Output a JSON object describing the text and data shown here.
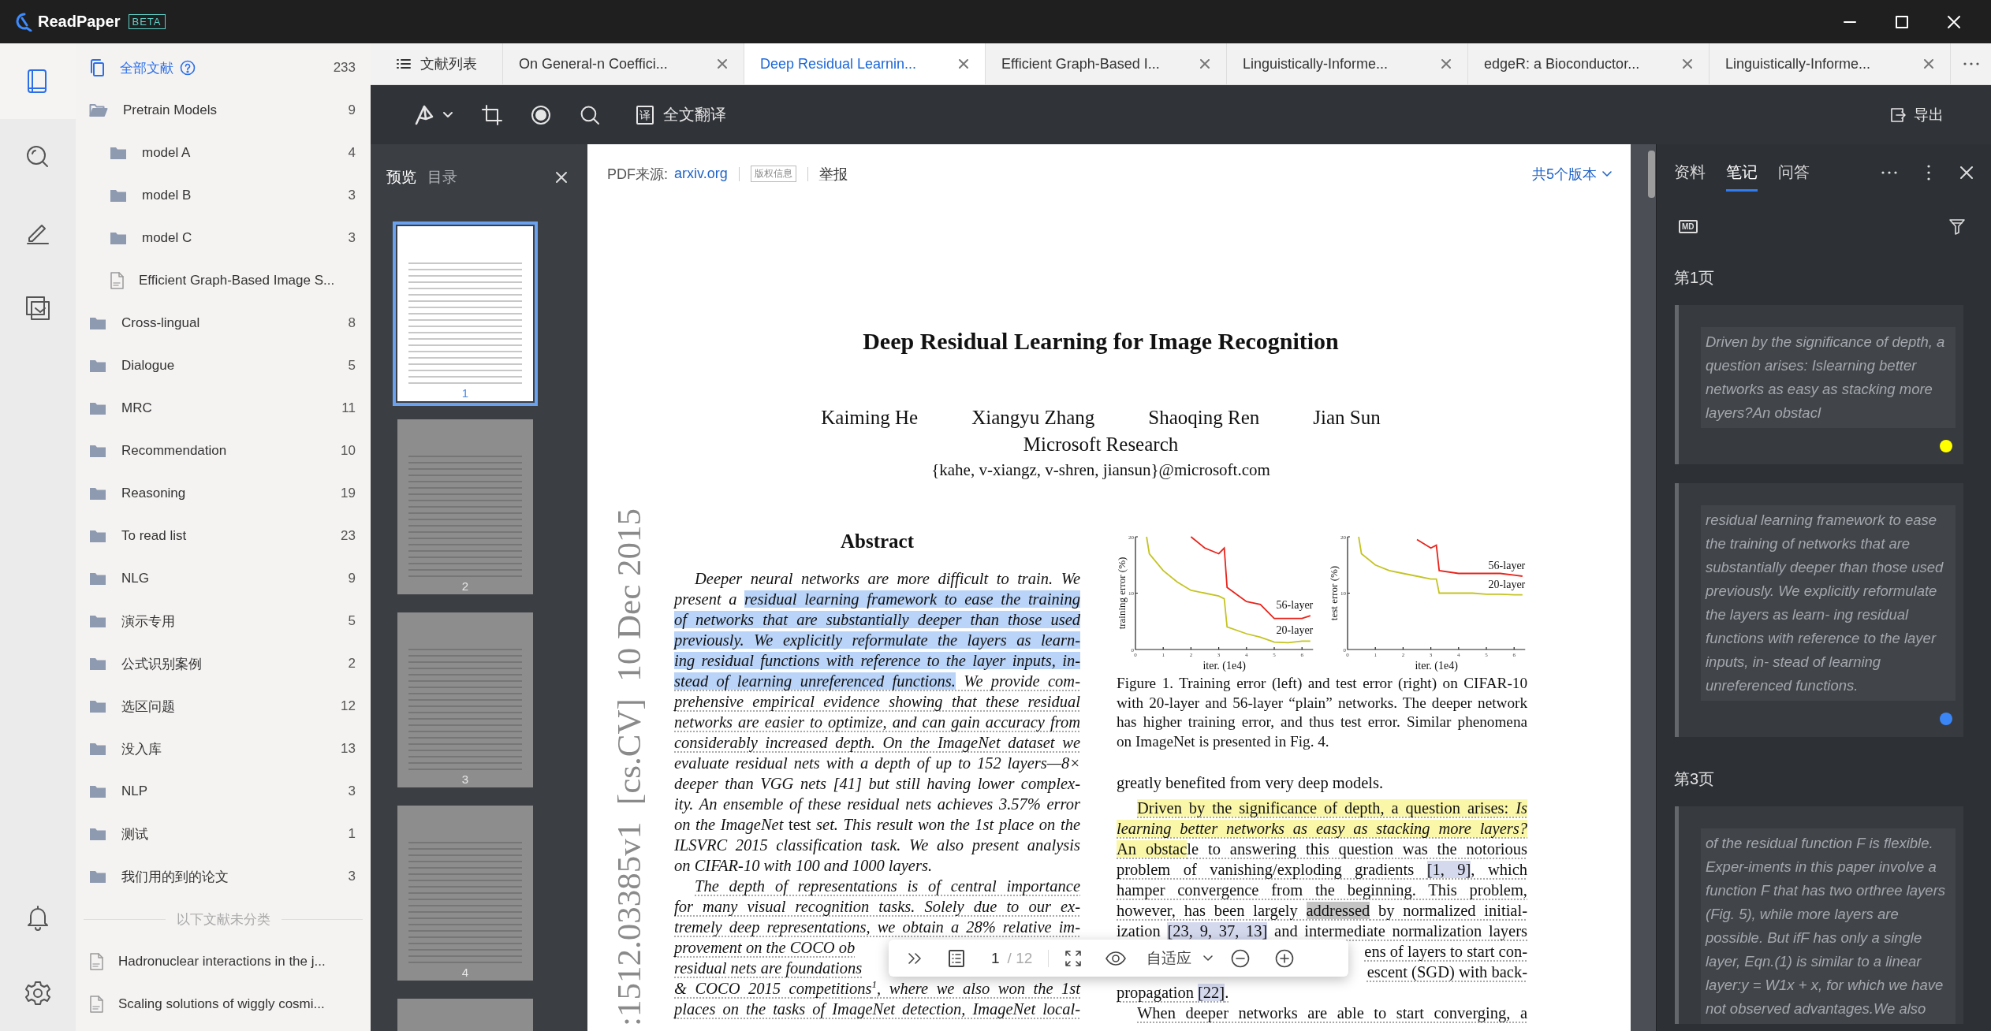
{
  "window": {
    "app_name": "ReadPaper",
    "badge": "BETA"
  },
  "rail": {
    "items": [
      {
        "kind": "library",
        "selected": true
      },
      {
        "kind": "search",
        "selected": false
      },
      {
        "kind": "notes",
        "selected": false
      },
      {
        "kind": "inbox",
        "selected": false
      }
    ],
    "bottom": [
      {
        "kind": "bell"
      },
      {
        "kind": "settings"
      }
    ]
  },
  "sidebar": {
    "all": {
      "label": "全部文献",
      "count": "233",
      "selected": true
    },
    "items": [
      {
        "kind": "folder",
        "label": "Pretrain Models",
        "count": "9",
        "expanded": true,
        "children": [
          {
            "kind": "folder",
            "label": "model A",
            "count": "4",
            "expanded": false
          },
          {
            "kind": "folder",
            "label": "model B",
            "count": "3",
            "expanded": false
          },
          {
            "kind": "folder",
            "label": "model C",
            "count": "3",
            "expanded": false
          },
          {
            "kind": "pdf",
            "label": "Efficient Graph-Based Image S..."
          }
        ]
      },
      {
        "kind": "folder",
        "label": "Cross-lingual",
        "count": "8",
        "expanded": false
      },
      {
        "kind": "folder",
        "label": "Dialogue",
        "count": "5",
        "expanded": false
      },
      {
        "kind": "folder",
        "label": "MRC",
        "count": "11",
        "expanded": false
      },
      {
        "kind": "folder",
        "label": "Recommendation",
        "count": "10",
        "expanded": false
      },
      {
        "kind": "folder",
        "label": "Reasoning",
        "count": "19",
        "expanded": false
      },
      {
        "kind": "folder",
        "label": "To read list",
        "count": "23",
        "expanded": false
      },
      {
        "kind": "folder",
        "label": "NLG",
        "count": "9",
        "expanded": false
      },
      {
        "kind": "folder",
        "label": "演示专用",
        "count": "5",
        "expanded": false
      },
      {
        "kind": "folder",
        "label": "公式识别案例",
        "count": "2",
        "expanded": false
      },
      {
        "kind": "folder",
        "label": "选区问题",
        "count": "12",
        "expanded": false
      },
      {
        "kind": "folder",
        "label": "没入库",
        "count": "13",
        "expanded": false
      },
      {
        "kind": "folder",
        "label": "NLP",
        "count": "3",
        "expanded": false
      },
      {
        "kind": "folder",
        "label": "测试",
        "count": "1",
        "expanded": false
      },
      {
        "kind": "folder",
        "label": "我们用的到的论文",
        "count": "3",
        "expanded": false
      }
    ],
    "unclassified_label": "以下文献未分类",
    "files": [
      {
        "kind": "pdf",
        "label": "Hadronuclear interactions in the j..."
      },
      {
        "kind": "pdf",
        "label": "Scaling solutions of wiggly cosmi..."
      }
    ]
  },
  "tabs": [
    {
      "kind": "list",
      "label": "文献列表",
      "selected": false
    },
    {
      "kind": "doc",
      "label": "On General-n Coeffici...",
      "selected": false
    },
    {
      "kind": "doc",
      "label": "Deep Residual Learnin...",
      "selected": true
    },
    {
      "kind": "doc",
      "label": "Efficient Graph-Based I...",
      "selected": false
    },
    {
      "kind": "doc",
      "label": "Linguistically-Informe...",
      "selected": false
    },
    {
      "kind": "doc",
      "label": "edgeR: a Bioconductor...",
      "selected": false
    },
    {
      "kind": "doc",
      "label": "Linguistically-Informe...",
      "selected": false
    }
  ],
  "toolbar": {
    "translate_icon": "译",
    "translate_label": "全文翻译",
    "export_label": "导出"
  },
  "preview": {
    "tabs": [
      {
        "label": "预览",
        "selected": true
      },
      {
        "label": "目录",
        "selected": false
      }
    ],
    "thumbnails": [
      {
        "page": "1",
        "selected": true
      },
      {
        "page": "2",
        "selected": false
      },
      {
        "page": "3",
        "selected": false
      },
      {
        "page": "4",
        "selected": false
      },
      {
        "selected": false
      }
    ]
  },
  "pdf": {
    "source_label": "PDF来源:",
    "source_link": "arxiv.org",
    "rights_badge": "版权信息",
    "report_link": "举报",
    "versions_link": "共5个版本",
    "arxiv_stamp": ":1512.03385v1  [cs.CV]  10 Dec 2015",
    "title": "Deep Residual Learning for Image Recognition",
    "authors": [
      "Kaiming He",
      "Xiangyu Zhang",
      "Shaoqing Ren",
      "Jian Sun"
    ],
    "affiliation": "Microsoft Research",
    "emails": "{kahe, v-xiangz, v-shren, jiansun}@microsoft.com",
    "abstract_heading": "Abstract",
    "left_lines": [
      {
        "kind": "full",
        "indent": true,
        "italic": true,
        "dotted": false,
        "segments": [
          {
            "text": "Deeper neural networks are more difficult to train. We"
          }
        ]
      },
      {
        "kind": "full",
        "indent": false,
        "italic": true,
        "dotted": false,
        "segments": [
          {
            "text": "present a "
          },
          {
            "text": "residual learning framework to ease the training",
            "color": "#b9d4f8"
          }
        ]
      },
      {
        "kind": "full",
        "indent": false,
        "italic": true,
        "dotted": false,
        "segments": [
          {
            "text": "of networks that are substantially deeper than those used",
            "color": "#b9d4f8"
          }
        ]
      },
      {
        "kind": "full",
        "indent": false,
        "italic": true,
        "dotted": false,
        "segments": [
          {
            "text": "previously. We explicitly reformulate the layers as learn-",
            "color": "#b9d4f8"
          }
        ]
      },
      {
        "kind": "full",
        "indent": false,
        "italic": true,
        "dotted": false,
        "segments": [
          {
            "text": "ing residual functions with reference to the layer inputs, in-",
            "color": "#b9d4f8"
          }
        ]
      },
      {
        "kind": "full",
        "indent": false,
        "italic": true,
        "dotted": true,
        "segments": [
          {
            "text": "stead of learning unreferenced functions.",
            "color": "#b9d4f8"
          },
          {
            "text": " We provide com-"
          }
        ]
      },
      {
        "kind": "full",
        "indent": false,
        "italic": true,
        "dotted": true,
        "segments": [
          {
            "text": "prehensive empirical evidence showing that these residual"
          }
        ]
      },
      {
        "kind": "full",
        "indent": false,
        "italic": true,
        "dotted": true,
        "segments": [
          {
            "text": "networks are easier to optimize, and can gain accuracy from"
          }
        ]
      },
      {
        "kind": "full",
        "indent": false,
        "italic": true,
        "dotted": true,
        "segments": [
          {
            "text": "considerably increased depth. On the ImageNet dataset we"
          }
        ]
      },
      {
        "kind": "full",
        "indent": false,
        "italic": true,
        "dotted": false,
        "segments": [
          {
            "text": "evaluate residual nets with a depth of up to 152 layers—8×"
          }
        ]
      },
      {
        "kind": "full",
        "indent": false,
        "italic": true,
        "dotted": false,
        "segments": [
          {
            "text": "deeper than VGG nets [41] but still having lower complex-"
          }
        ]
      },
      {
        "kind": "full",
        "indent": false,
        "italic": true,
        "dotted": false,
        "segments": [
          {
            "text": "ity. An ensemble of these residual nets achieves 3.57% error"
          }
        ]
      },
      {
        "kind": "full",
        "indent": false,
        "italic": false,
        "dotted": false,
        "segments": [
          {
            "text": "*on the ImageNet* test *set. This result won the 1st place on the*"
          }
        ]
      },
      {
        "kind": "full",
        "indent": false,
        "italic": true,
        "dotted": false,
        "segments": [
          {
            "text": "ILSVRC 2015 classification task. We also present analysis"
          }
        ]
      },
      {
        "kind": "last",
        "indent": false,
        "italic": true,
        "dotted": false,
        "segments": [
          {
            "text": "on CIFAR-10 with 100 and 1000 layers."
          }
        ]
      },
      {
        "kind": "full",
        "indent": true,
        "italic": true,
        "dotted": true,
        "segments": [
          {
            "text": "The depth of representations is of central importance"
          }
        ]
      },
      {
        "kind": "full",
        "indent": false,
        "italic": true,
        "dotted": true,
        "segments": [
          {
            "text": "for many visual recognition tasks. Solely due to our ex-"
          }
        ]
      },
      {
        "kind": "full",
        "indent": false,
        "italic": true,
        "dotted": true,
        "segments": [
          {
            "text": "tremely deep representations, we obtain a 28% relative im-"
          }
        ]
      },
      {
        "kind": "head",
        "indent": false,
        "italic": true,
        "dotted": true,
        "segments": [
          {
            "text": "provement on the COCO ob"
          }
        ]
      },
      {
        "kind": "head",
        "indent": false,
        "italic": true,
        "dotted": true,
        "segments": [
          {
            "text": "residual nets are foundations"
          }
        ]
      },
      {
        "kind": "full",
        "indent": false,
        "italic": true,
        "dotted": true,
        "segments": [
          {
            "text": "& COCO 2015 competitions$^{1}$, where we also won the 1st"
          }
        ]
      },
      {
        "kind": "full",
        "indent": false,
        "italic": true,
        "dotted": true,
        "segments": [
          {
            "text": "places on the tasks of ImageNet detection, ImageNet local-"
          }
        ]
      }
    ],
    "figure": {
      "charts": [
        {
          "chart_data": {
            "type": "line",
            "xlabel": "iter. (1e4)",
            "ylabel": "training error (%)",
            "x": [
              0.4,
              0.5,
              1,
              1.5,
              2,
              2.5,
              3,
              3.2,
              3.3,
              4,
              4.5,
              5,
              5.5,
              6,
              6.3
            ],
            "series": [
              {
                "name": "56-layer",
                "color": "#e8231b",
                "values": [
                  null,
                  null,
                  null,
                  null,
                  20,
                  18,
                  17,
                  18,
                  11,
                  8.5,
                  8,
                  5.5,
                  5.5,
                  5.5,
                  6
                ]
              },
              {
                "name": "20-layer",
                "color": "#c4c424",
                "values": [
                  20,
                  17,
                  14,
                  12,
                  10.5,
                  10,
                  9.5,
                  9,
                  4,
                  2.8,
                  2.2,
                  1.3,
                  1.2,
                  1.5,
                  1.5
                ]
              }
            ],
            "xlim": [
              0,
              6.4
            ],
            "ylim": [
              0,
              20
            ],
            "xticks": [
              0,
              1,
              2,
              3,
              4,
              5,
              6
            ],
            "yticks": [
              0,
              10,
              20
            ]
          }
        },
        {
          "chart_data": {
            "type": "line",
            "xlabel": "iter. (1e4)",
            "ylabel": "test error (%)",
            "x": [
              0.4,
              0.5,
              1,
              1.5,
              2,
              2.5,
              3,
              3.2,
              3.3,
              4,
              4.5,
              5,
              5.5,
              6,
              6.3
            ],
            "series": [
              {
                "name": "56-layer",
                "color": "#e8231b",
                "values": [
                  null,
                  null,
                  null,
                  null,
                  null,
                  19.5,
                  18,
                  18.5,
                  14,
                  13.5,
                  13.5,
                  13.5,
                  13.5,
                  13.2,
                  13
                ]
              },
              {
                "name": "20-layer",
                "color": "#c4c424",
                "values": [
                  20,
                  17,
                  15,
                  14,
                  13.5,
                  13,
                  12.5,
                  12.5,
                  10,
                  10,
                  10,
                  9.8,
                  9.8,
                  9.7,
                  9.7
                ]
              }
            ],
            "xlim": [
              0,
              6.4
            ],
            "ylim": [
              0,
              20
            ],
            "xticks": [
              0,
              1,
              2,
              3,
              4,
              5,
              6
            ],
            "yticks": [
              0,
              10,
              20
            ]
          }
        }
      ],
      "caption_lines": [
        "Figure 1. Training error (left) and test error (right) on CIFAR-10",
        "with 20-layer and 56-layer “plain” networks. The deeper network",
        "has higher training error, and thus test error. Similar phenomena",
        "on ImageNet is presented in Fig. 4."
      ]
    },
    "right_lines": [
      {
        "kind": "last",
        "indent": false,
        "italic": false,
        "dotted": false,
        "segments": [
          {
            "text": "greatly benefited from very deep models."
          }
        ]
      },
      {
        "kind": "full",
        "indent": true,
        "italic": false,
        "dotted": true,
        "segments": [
          {
            "text": "Driven by the significance of depth, a question arises: *Is*",
            "color": "#fbf7a8"
          }
        ]
      },
      {
        "kind": "full",
        "indent": false,
        "italic": false,
        "dotted": true,
        "segments": [
          {
            "text": "*learning better networks as easy as stacking more layers?*",
            "color": "#fbf7a8"
          }
        ]
      },
      {
        "kind": "full",
        "indent": false,
        "italic": false,
        "dotted": true,
        "segments": [
          {
            "text": "An obstac",
            "color": "#fbf7a8"
          },
          {
            "text": "le to answering this question was the notorious"
          }
        ]
      },
      {
        "kind": "full",
        "indent": false,
        "italic": false,
        "dotted": true,
        "segments": [
          {
            "text": "problem of vanishing/exploding gradients "
          },
          {
            "text": "[1, 9]",
            "color": "#d5d9ee"
          },
          {
            "text": ", which"
          }
        ]
      },
      {
        "kind": "full",
        "indent": false,
        "italic": false,
        "dotted": true,
        "segments": [
          {
            "text": "hamper convergence from the beginning. This problem,"
          }
        ]
      },
      {
        "kind": "full",
        "indent": false,
        "italic": false,
        "dotted": true,
        "segments": [
          {
            "text": "however, has been largely "
          },
          {
            "text": "addressed",
            "color": "#c4c4c4"
          },
          {
            "text": " by normalized initial-"
          }
        ]
      },
      {
        "kind": "full",
        "indent": false,
        "italic": false,
        "dotted": true,
        "segments": [
          {
            "text": "ization "
          },
          {
            "text": "[23, 9, 37, 13]",
            "color": "#d5d9ee"
          },
          {
            "text": " and intermediate normalization layers"
          }
        ]
      },
      {
        "kind": "tail",
        "indent": false,
        "italic": false,
        "dotted": true,
        "segments": [
          {
            "text": "ens of layers to start con-"
          }
        ]
      },
      {
        "kind": "tail",
        "indent": false,
        "italic": false,
        "dotted": true,
        "segments": [
          {
            "text": "escent (SGD) with back-"
          }
        ]
      },
      {
        "kind": "last",
        "indent": false,
        "italic": false,
        "dotted": true,
        "segments": [
          {
            "text": "propagation "
          },
          {
            "text": "[22]",
            "color": "#d5d9ee"
          },
          {
            "text": "."
          }
        ]
      },
      {
        "kind": "full",
        "indent": true,
        "italic": false,
        "dotted": true,
        "segments": [
          {
            "text": "When deeper networks are able to start converging, a"
          }
        ]
      }
    ]
  },
  "viewer_toolbar": {
    "page": "1",
    "page_total": "/ 12",
    "zoom_label": "自适应"
  },
  "notes_panel": {
    "tabs": [
      {
        "label": "资料",
        "selected": false
      },
      {
        "label": "笔记",
        "selected": true
      },
      {
        "label": "问答",
        "selected": false
      }
    ],
    "md_badge": "MD",
    "groups": [
      {
        "heading": "第1页",
        "notes": [
          {
            "text": "Driven by the significance of depth, a question arises: Islearning better networks as easy as stacking more layers?An obstacl",
            "color": "#ffff00"
          },
          {
            "text": "residual learning framework to ease the training of networks that are substantially deeper than those used previously. We explicitly reformulate the layers as learn- ing residual functions with reference to the layer inputs, in- stead of learning unreferenced functions.",
            "color": "#3b86f7"
          }
        ]
      },
      {
        "heading": "第3页",
        "notes": [
          {
            "text": "of the residual function F is flexible. Exper-iments in this paper involve a function F that has two orthree layers (Fig. 5), while more layers are possible. But ifF has only a single layer, Eqn.(1) is similar to a linear layer:y = W1x + x, for which we have not observed advantages.We also"
          }
        ]
      }
    ]
  }
}
